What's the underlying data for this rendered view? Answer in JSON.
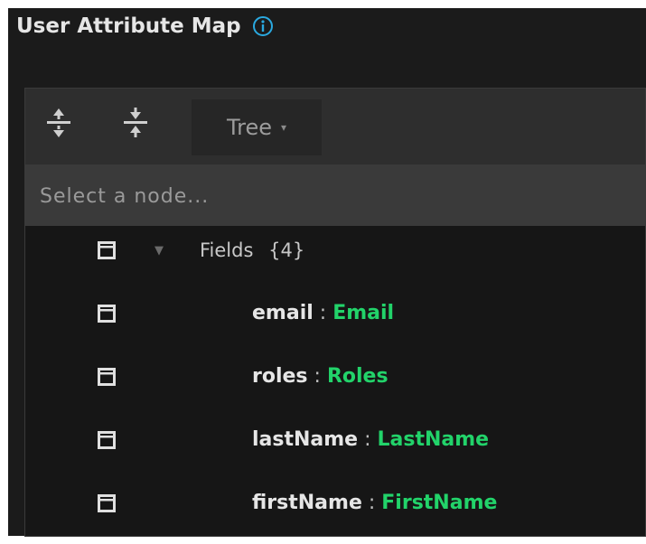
{
  "header": {
    "title": "User Attribute Map",
    "info_icon": "info-circle-icon",
    "accent_color": "#2aa9e0"
  },
  "toolbar": {
    "expand_all_icon": "expand-all-icon",
    "collapse_all_icon": "collapse-all-icon",
    "mode_label": "Tree",
    "mode_caret": "▾"
  },
  "search": {
    "placeholder": "Select a node..."
  },
  "tree": {
    "root": {
      "label": "Fields",
      "count": "{4}",
      "expander": "▼"
    },
    "fields": [
      {
        "key": "email",
        "sep": " : ",
        "value": "Email"
      },
      {
        "key": "roles",
        "sep": " : ",
        "value": "Roles"
      },
      {
        "key": "lastName",
        "sep": " : ",
        "value": "LastName"
      },
      {
        "key": "firstName",
        "sep": " : ",
        "value": "FirstName"
      }
    ]
  },
  "colors": {
    "value_green": "#22d36a",
    "background": "#1b1b1b"
  }
}
